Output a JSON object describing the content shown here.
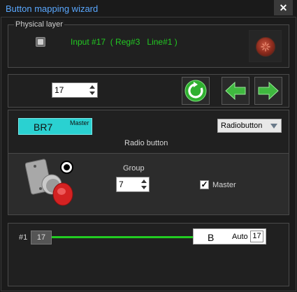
{
  "window": {
    "title": "Button mapping wizard",
    "close_glyph": "✕"
  },
  "physical": {
    "legend": "Physical layer",
    "input_label": "Input #17  ( Reg#3   Line#1 )"
  },
  "nav": {
    "index_value": "17",
    "refresh_icon": "refresh-icon",
    "prev_icon": "arrow-left-icon",
    "next_icon": "arrow-right-icon"
  },
  "config": {
    "button_name": "BR7",
    "button_tag": "Master",
    "type_select": "Radiobutton",
    "type_caption": "Radio button",
    "group_label": "Group",
    "group_value": "7",
    "master_label": "Master",
    "master_checked": true
  },
  "mapping": {
    "line_label": "#1",
    "source_value": "17",
    "target_letter": "B",
    "auto_label": "Auto",
    "target_value": "17",
    "link_color": "#22cc22"
  }
}
